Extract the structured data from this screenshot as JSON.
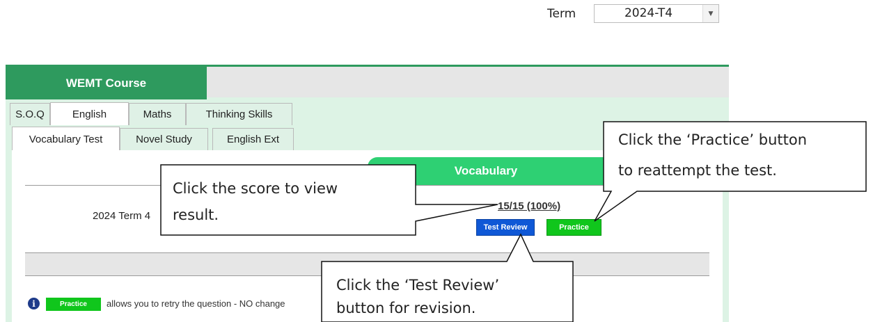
{
  "term_selector": {
    "label": "Term",
    "value": "2024-T4"
  },
  "course": {
    "title": "WEMT Course"
  },
  "subject_tabs": [
    {
      "label": "S.O.Q",
      "active": false
    },
    {
      "label": "English",
      "active": true
    },
    {
      "label": "Maths",
      "active": false
    },
    {
      "label": "Thinking Skills",
      "active": false
    }
  ],
  "english_tabs": [
    {
      "label": "Vocabulary Test",
      "active": true
    },
    {
      "label": "Novel Study",
      "active": false
    },
    {
      "label": "English Ext",
      "active": false
    }
  ],
  "vocabulary": {
    "column_title": "Vocabulary",
    "row_label": "2024 Term 4",
    "score": "15/15 (100%)",
    "review_button": "Test Review",
    "practice_button": "Practice"
  },
  "footer_note": {
    "badge": "Practice",
    "text": "allows you to retry the question - NO change"
  },
  "callouts": {
    "score": {
      "line1": "Click the score to view",
      "line2": "result."
    },
    "practice": {
      "line1": "Click the ‘Practice’ button",
      "line2": "to reattempt the test."
    },
    "review": {
      "line1": "Click the ‘Test Review’",
      "line2": "button for revision."
    }
  },
  "colors": {
    "course_green": "#2e9a5e",
    "vocab_green": "#2ed073",
    "review_blue": "#0f58d6",
    "practice_green": "#10c61c",
    "panel_bg": "#ddf3e5"
  }
}
